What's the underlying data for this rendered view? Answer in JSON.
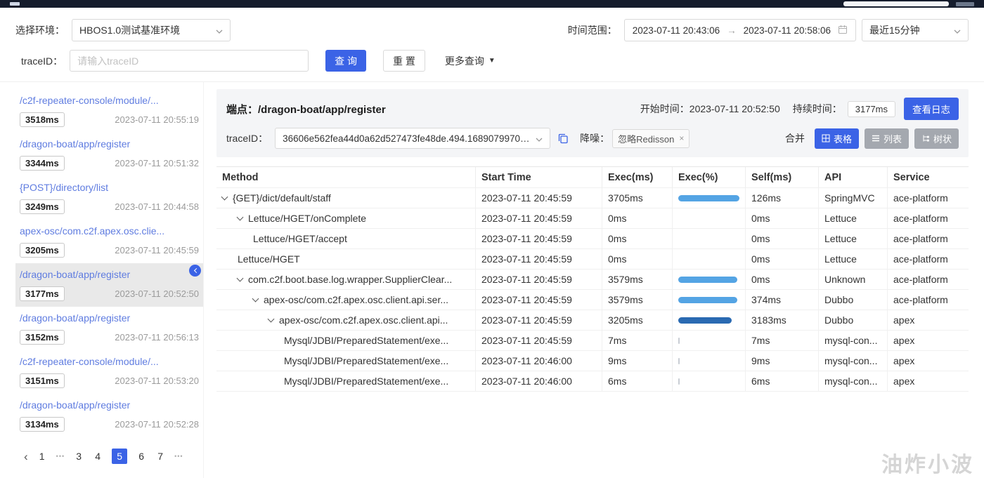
{
  "filters": {
    "env_label": "选择环境：",
    "env_value": "HBOS1.0测试基准环境",
    "time_label": "时间范围：",
    "time_start": "2023-07-11 20:43:06",
    "time_separator": "→",
    "time_end": "2023-07-11 20:58:06",
    "quick_range": "最近15分钟",
    "traceid_label": "traceID：",
    "traceid_placeholder": "请输入traceID",
    "query_button": "查 询",
    "reset_button": "重 置",
    "more_link": "更多查询",
    "more_caret": "▼"
  },
  "sidebar": {
    "items": [
      {
        "path": "/c2f-repeater-console/module/...",
        "duration": "3518ms",
        "time": "2023-07-11 20:55:19",
        "selected": false
      },
      {
        "path": "/dragon-boat/app/register",
        "duration": "3344ms",
        "time": "2023-07-11 20:51:32",
        "selected": false
      },
      {
        "path": "{POST}/directory/list",
        "duration": "3249ms",
        "time": "2023-07-11 20:44:58",
        "selected": false
      },
      {
        "path": "apex-osc/com.c2f.apex.osc.clie...",
        "duration": "3205ms",
        "time": "2023-07-11 20:45:59",
        "selected": false
      },
      {
        "path": "/dragon-boat/app/register",
        "duration": "3177ms",
        "time": "2023-07-11 20:52:50",
        "selected": true
      },
      {
        "path": "/dragon-boat/app/register",
        "duration": "3152ms",
        "time": "2023-07-11 20:56:13",
        "selected": false
      },
      {
        "path": "/c2f-repeater-console/module/...",
        "duration": "3151ms",
        "time": "2023-07-11 20:53:20",
        "selected": false
      },
      {
        "path": "/dragon-boat/app/register",
        "duration": "3134ms",
        "time": "2023-07-11 20:52:28",
        "selected": false
      }
    ],
    "pagination": {
      "prev": "‹",
      "items": [
        {
          "label": "1",
          "type": "page",
          "active": false
        },
        {
          "label": "•••",
          "type": "dots",
          "active": false
        },
        {
          "label": "3",
          "type": "page",
          "active": false
        },
        {
          "label": "4",
          "type": "page",
          "active": false
        },
        {
          "label": "5",
          "type": "page",
          "active": true
        },
        {
          "label": "6",
          "type": "page",
          "active": false
        },
        {
          "label": "7",
          "type": "page",
          "active": false
        },
        {
          "label": "•••",
          "type": "dots",
          "active": false
        }
      ]
    }
  },
  "panel": {
    "endpoint_label": "端点：",
    "endpoint_value": "/dragon-boat/app/register",
    "start_time_label": "开始时间：",
    "start_time_value": "2023-07-11 20:52:50",
    "duration_label": "持续时间：",
    "duration_value": "3177ms",
    "view_log_button": "查看日志",
    "traceid_label": "traceID：",
    "traceid_value": "36606e562fea44d0a62d527473fe48de.494.168907997086...",
    "denoise_label": "降噪：",
    "denoise_tag": "忽略Redisson",
    "denoise_tag_close": "×",
    "merge_label": "合并",
    "view_table": "表格",
    "view_list": "列表",
    "view_tree": "树状"
  },
  "table": {
    "headers": [
      "Method",
      "Start Time",
      "Exec(ms)",
      "Exec(%)",
      "Self(ms)",
      "API",
      "Service"
    ],
    "rows": [
      {
        "indent": 0,
        "caret": true,
        "method": "{GET}/dict/default/staff",
        "start": "2023-07-11 20:45:59",
        "exec": "3705ms",
        "pct": 100,
        "bar": "light",
        "self": "126ms",
        "api": "SpringMVC",
        "service": "ace-platform"
      },
      {
        "indent": 1,
        "caret": true,
        "method": "Lettuce/HGET/onComplete",
        "start": "2023-07-11 20:45:59",
        "exec": "0ms",
        "pct": 0,
        "bar": "none",
        "self": "0ms",
        "api": "Lettuce",
        "service": "ace-platform"
      },
      {
        "indent": 2,
        "caret": false,
        "method": "Lettuce/HGET/accept",
        "start": "2023-07-11 20:45:59",
        "exec": "0ms",
        "pct": 0,
        "bar": "none",
        "self": "0ms",
        "api": "Lettuce",
        "service": "ace-platform"
      },
      {
        "indent": 1,
        "caret": false,
        "method": "Lettuce/HGET",
        "start": "2023-07-11 20:45:59",
        "exec": "0ms",
        "pct": 0,
        "bar": "none",
        "self": "0ms",
        "api": "Lettuce",
        "service": "ace-platform"
      },
      {
        "indent": 1,
        "caret": true,
        "method": "com.c2f.boot.base.log.wrapper.SupplierClear...",
        "start": "2023-07-11 20:45:59",
        "exec": "3579ms",
        "pct": 97,
        "bar": "light",
        "self": "0ms",
        "api": "Unknown",
        "service": "ace-platform"
      },
      {
        "indent": 2,
        "caret": true,
        "method": "apex-osc/com.c2f.apex.osc.client.api.ser...",
        "start": "2023-07-11 20:45:59",
        "exec": "3579ms",
        "pct": 97,
        "bar": "light",
        "self": "374ms",
        "api": "Dubbo",
        "service": "ace-platform"
      },
      {
        "indent": 3,
        "caret": true,
        "method": "apex-osc/com.c2f.apex.osc.client.api...",
        "start": "2023-07-11 20:45:59",
        "exec": "3205ms",
        "pct": 87,
        "bar": "dark",
        "self": "3183ms",
        "api": "Dubbo",
        "service": "apex"
      },
      {
        "indent": 4,
        "caret": false,
        "method": "Mysql/JDBI/PreparedStatement/exe...",
        "start": "2023-07-11 20:45:59",
        "exec": "7ms",
        "pct": 1,
        "bar": "tiny",
        "self": "7ms",
        "api": "mysql-con...",
        "service": "apex"
      },
      {
        "indent": 4,
        "caret": false,
        "method": "Mysql/JDBI/PreparedStatement/exe...",
        "start": "2023-07-11 20:46:00",
        "exec": "9ms",
        "pct": 1,
        "bar": "tiny",
        "self": "9ms",
        "api": "mysql-con...",
        "service": "apex"
      },
      {
        "indent": 4,
        "caret": false,
        "method": "Mysql/JDBI/PreparedStatement/exe...",
        "start": "2023-07-11 20:46:00",
        "exec": "6ms",
        "pct": 1,
        "bar": "tiny",
        "self": "6ms",
        "api": "mysql-con...",
        "service": "apex"
      }
    ]
  },
  "watermark": "油炸小波",
  "colors": {
    "primary": "#3b63e6",
    "link": "#5f7ce0",
    "bar_light": "#54a4e4",
    "bar_dark": "#2a6ab2",
    "bar_tiny": "#c8cdd4"
  }
}
